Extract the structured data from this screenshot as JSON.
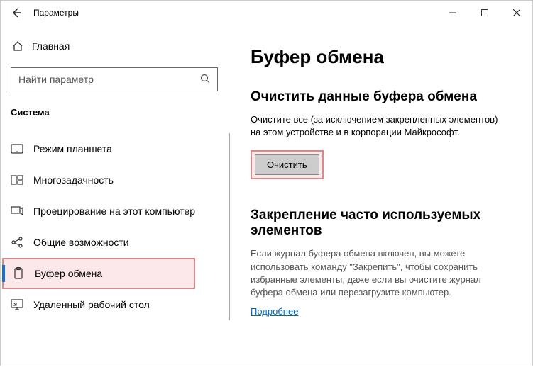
{
  "titlebar": {
    "title": "Параметры"
  },
  "sidebar": {
    "home_label": "Главная",
    "search_placeholder": "Найти параметр",
    "section_label": "Система",
    "items": [
      {
        "label": "Режим планшета"
      },
      {
        "label": "Многозадачность"
      },
      {
        "label": "Проецирование на этот компьютер"
      },
      {
        "label": "Общие возможности"
      },
      {
        "label": "Буфер обмена"
      },
      {
        "label": "Удаленный рабочий стол"
      }
    ]
  },
  "content": {
    "page_title": "Буфер обмена",
    "clear_section": {
      "heading": "Очистить данные буфера обмена",
      "description": "Очистите все (за исключением закрепленных элементов) на этом устройстве и в корпорации Майкрософт.",
      "button_label": "Очистить"
    },
    "pin_section": {
      "heading": "Закрепление часто используемых элементов",
      "description": "Если журнал буфера обмена включен, вы можете использовать команду \"Закрепить\", чтобы сохранить избранные элементы, даже если вы очистите журнал буфера обмена или перезагрузите компьютер.",
      "link_label": "Подробнее"
    }
  }
}
